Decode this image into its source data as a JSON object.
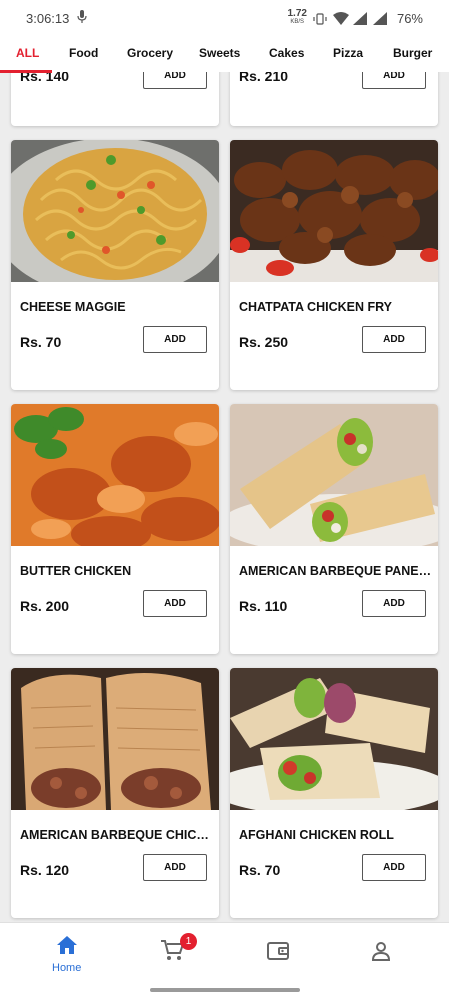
{
  "status_bar": {
    "time": "3:06:13",
    "net_speed": "1.72",
    "net_unit": "KB/S",
    "battery": "76%"
  },
  "tabs": [
    {
      "label": "ALL",
      "active": true
    },
    {
      "label": "Food"
    },
    {
      "label": "Grocery"
    },
    {
      "label": "Sweets"
    },
    {
      "label": "Cakes"
    },
    {
      "label": "Pizza"
    },
    {
      "label": "Burger"
    }
  ],
  "partial_row": [
    {
      "price": "Rs. 140",
      "add_label": "ADD"
    },
    {
      "price": "Rs. 210",
      "add_label": "ADD"
    }
  ],
  "products": [
    {
      "name": "CHEESE MAGGIE",
      "price": "Rs. 70",
      "add_label": "ADD",
      "image": "noodles-image"
    },
    {
      "name": "CHATPATA CHICKEN FRY",
      "price": "Rs. 250",
      "add_label": "ADD",
      "image": "fried-chicken-image"
    },
    {
      "name": "BUTTER CHICKEN",
      "price": "Rs. 200",
      "add_label": "ADD",
      "image": "curry-image"
    },
    {
      "name": "AMERICAN BARBEQUE PANEE...",
      "price": "Rs. 110",
      "add_label": "ADD",
      "image": "wrap-image"
    },
    {
      "name": "AMERICAN BARBEQUE CHICK...",
      "price": "Rs. 120",
      "add_label": "ADD",
      "image": "roll-image"
    },
    {
      "name": "AFGHANI CHICKEN ROLL",
      "price": "Rs. 70",
      "add_label": "ADD",
      "image": "roll-image"
    }
  ],
  "bottom_nav": {
    "home_label": "Home",
    "cart_count": "1"
  },
  "colors": {
    "accent": "#e3202f",
    "nav_active": "#2a6fd6"
  }
}
